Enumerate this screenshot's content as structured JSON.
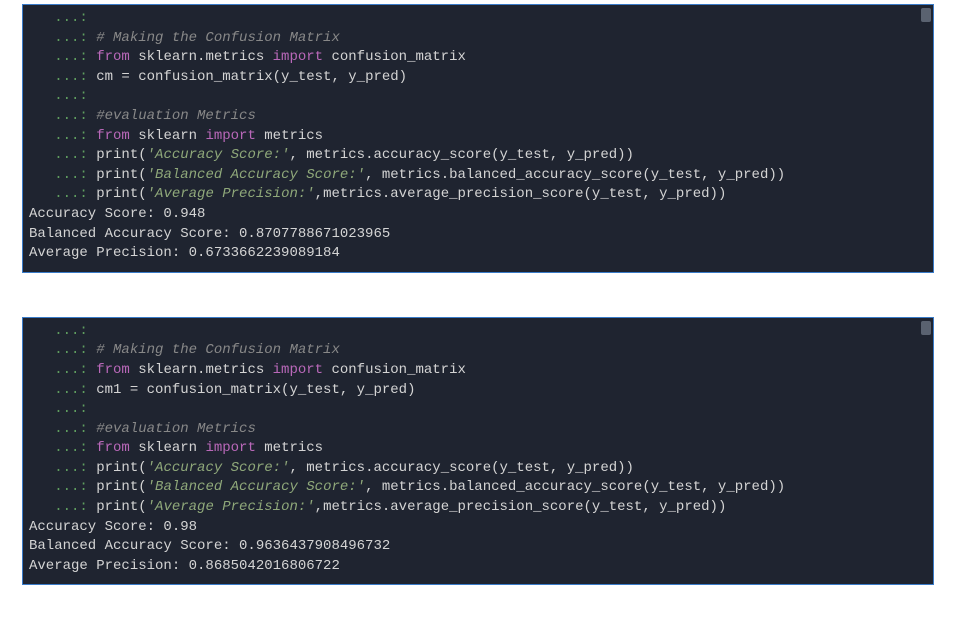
{
  "block1": {
    "prompt": "   ...: ",
    "lines": {
      "l0": "",
      "l1_comment": "# Making the Confusion Matrix",
      "l2_from": "from ",
      "l2_pkg": "sklearn.metrics ",
      "l2_import": "import ",
      "l2_name": "confusion_matrix",
      "l3": "cm = confusion_matrix(y_test, y_pred)",
      "l4": "",
      "l5_comment": "#evaluation Metrics",
      "l6_from": "from ",
      "l6_pkg": "sklearn ",
      "l6_import": "import ",
      "l6_name": "metrics",
      "l7_print": "print(",
      "l7_str": "'Accuracy Score:'",
      "l7_rest": ", metrics.accuracy_score(y_test, y_pred))",
      "l8_print": "print(",
      "l8_str": "'Balanced Accuracy Score:'",
      "l8_rest": ", metrics.balanced_accuracy_score(y_test, y_pred))",
      "l9_print": "print(",
      "l9_str": "'Average Precision:'",
      "l9_rest": ",metrics.average_precision_score(y_test, y_pred))"
    },
    "output": {
      "o1": "Accuracy Score: 0.948",
      "o2": "Balanced Accuracy Score: 0.8707788671023965",
      "o3": "Average Precision: 0.6733662239089184"
    }
  },
  "block2": {
    "prompt": "   ...: ",
    "lines": {
      "l0": "",
      "l1_comment": "# Making the Confusion Matrix",
      "l2_from": "from ",
      "l2_pkg": "sklearn.metrics ",
      "l2_import": "import ",
      "l2_name": "confusion_matrix",
      "l3": "cm1 = confusion_matrix(y_test, y_pred)",
      "l4": "",
      "l5_comment": "#evaluation Metrics",
      "l6_from": "from ",
      "l6_pkg": "sklearn ",
      "l6_import": "import ",
      "l6_name": "metrics",
      "l7_print": "print(",
      "l7_str": "'Accuracy Score:'",
      "l7_rest": ", metrics.accuracy_score(y_test, y_pred))",
      "l8_print": "print(",
      "l8_str": "'Balanced Accuracy Score:'",
      "l8_rest": ", metrics.balanced_accuracy_score(y_test, y_pred))",
      "l9_print": "print(",
      "l9_str": "'Average Precision:'",
      "l9_rest": ",metrics.average_precision_score(y_test, y_pred))"
    },
    "output": {
      "o1": "Accuracy Score: 0.98",
      "o2": "Balanced Accuracy Score: 0.9636437908496732",
      "o3": "Average Precision: 0.8685042016806722"
    }
  }
}
